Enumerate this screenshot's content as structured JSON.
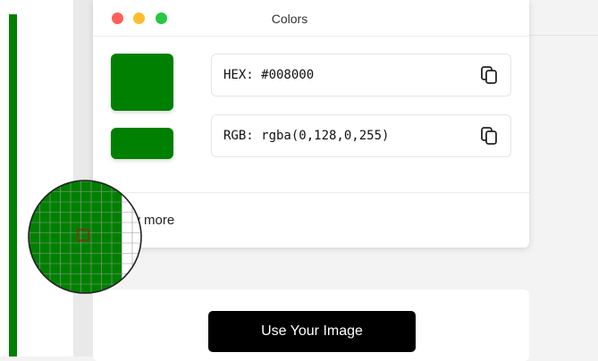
{
  "window": {
    "title": "Colors",
    "controls": [
      "close",
      "minimize",
      "maximize"
    ]
  },
  "color": {
    "hex_text": "HEX: #008000",
    "rgb_text": "RGB: rgba(0,128,0,255)",
    "swatch_color": "#008000"
  },
  "actions": {
    "show_more_label": "w more",
    "use_image_label": "Use Your Image"
  },
  "icons": {
    "copy_hex": "copy-icon",
    "copy_rgb": "copy-icon",
    "magnifier": "magnifier-loupe"
  },
  "colors": {
    "accent_green": "#008000",
    "button_black": "#000000",
    "close_dot": "#fe5f57",
    "minimize_dot": "#febc2e",
    "maximize_dot": "#28c840"
  }
}
